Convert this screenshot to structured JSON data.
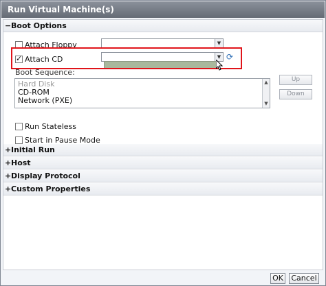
{
  "dialog": {
    "title": "Run Virtual Machine(s)",
    "close_glyph": "×"
  },
  "sections": {
    "boot_options": {
      "toggle": "−",
      "label": "Boot Options"
    },
    "initial_run": {
      "toggle": "+",
      "label": "Initial Run"
    },
    "host": {
      "toggle": "+",
      "label": "Host"
    },
    "display_protocol": {
      "toggle": "+",
      "label": "Display Protocol"
    },
    "custom_properties": {
      "toggle": "+",
      "label": "Custom Properties"
    }
  },
  "boot": {
    "attach_floppy": {
      "label": "Attach Floppy",
      "checked": false,
      "value": ""
    },
    "attach_cd": {
      "label": "Attach CD",
      "checked": true,
      "value": ""
    },
    "boot_sequence": {
      "label": "Boot Sequence:",
      "items": [
        "Hard Disk",
        "CD-ROM",
        "Network (PXE)"
      ]
    },
    "up_label": "Up",
    "down_label": "Down",
    "run_stateless": {
      "label": "Run Stateless",
      "checked": false
    },
    "start_paused": {
      "label": "Start in Pause Mode",
      "checked": false
    }
  },
  "footer": {
    "ok_label": "OK",
    "cancel_label": "Cancel"
  },
  "icons": {
    "refresh": "refresh-icon",
    "dropdown": "chevron-down-icon",
    "cursor": "mouse-cursor-icon"
  },
  "colors": {
    "highlight_frame": "#e0141a",
    "titlebar": "#6f7580",
    "dropdown_panel": "#a9b89c"
  }
}
